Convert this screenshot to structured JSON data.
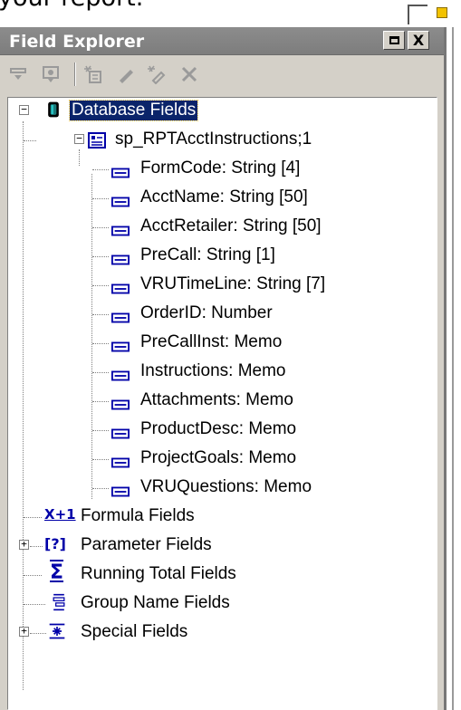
{
  "background_text": "your report.",
  "panel": {
    "title": "Field Explorer",
    "buttons": {
      "maximize": "maximize",
      "close": "X"
    }
  },
  "toolbar": {
    "icons": [
      "insert-field-icon",
      "browse-field-icon",
      "new-field-icon",
      "edit-field-icon",
      "rename-field-icon",
      "delete-field-icon"
    ]
  },
  "tree": {
    "database_fields": {
      "label": "Database Fields",
      "expanded": true,
      "selected": true,
      "table": {
        "label": "sp_RPTAcctInstructions;1",
        "expanded": true,
        "fields": [
          "FormCode: String [4]",
          "AcctName: String [50]",
          "AcctRetailer: String [50]",
          "PreCall: String [1]",
          "VRUTimeLine: String [7]",
          "OrderID: Number",
          "PreCallInst: Memo",
          "Instructions: Memo",
          "Attachments: Memo",
          "ProductDesc: Memo",
          "ProjectGoals: Memo",
          "VRUQuestions: Memo"
        ]
      }
    },
    "formula_fields": {
      "label": "Formula Fields",
      "icon_text": "X+1"
    },
    "parameter_fields": {
      "label": "Parameter Fields",
      "icon_text": "[?]",
      "expandable": true
    },
    "running_total_fields": {
      "label": "Running Total Fields",
      "icon_text": "Σ"
    },
    "group_name_fields": {
      "label": "Group Name Fields"
    },
    "special_fields": {
      "label": "Special Fields",
      "expandable": true
    }
  },
  "colors": {
    "selection": "#0a246a",
    "titlebar": "#808080",
    "chrome": "#d4d0c8",
    "icon_blue": "#0000a8"
  }
}
